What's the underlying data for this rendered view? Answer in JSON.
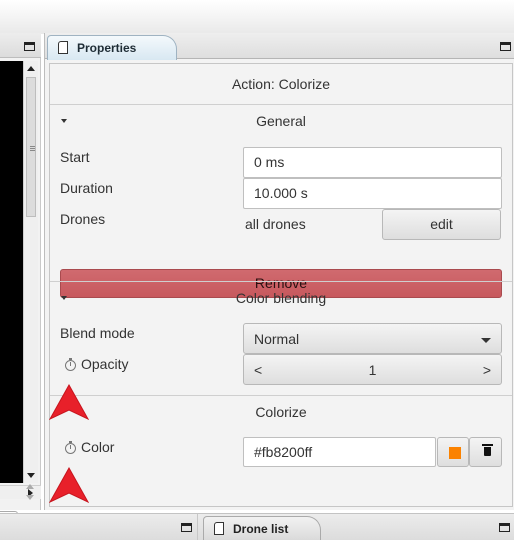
{
  "properties_tab": {
    "label": "Properties"
  },
  "action": {
    "title": "Action: Colorize"
  },
  "general": {
    "title": "General",
    "start_label": "Start",
    "start_value": "0 ms",
    "duration_label": "Duration",
    "duration_value": "10.000 s",
    "drones_label": "Drones",
    "drones_value": "all drones",
    "edit_label": "edit",
    "remove_label": "Remove"
  },
  "color_blending": {
    "title": "Color blending",
    "blend_mode_label": "Blend mode",
    "blend_mode_value": "Normal",
    "opacity_label": "Opacity",
    "opacity_value": "1",
    "decrement_glyph": "<",
    "increment_glyph": ">"
  },
  "colorize": {
    "title": "Colorize",
    "color_label": "Color",
    "color_value": "#fb8200ff",
    "swatch_color": "#fb8200"
  },
  "bottom": {
    "drone_list_tab": "Drone list"
  },
  "icons": {
    "tab_icon": "document-icon",
    "maximize": "maximize-icon",
    "collapse": "caret-down-icon",
    "animated_property": "stopwatch-icon",
    "delete": "trash-icon",
    "pointer": "red-arrow-pointer-icon"
  },
  "colors": {
    "remove_button": "#c7585d",
    "tab_active": "#d8e8f2",
    "cursor_red": "#e8202a"
  }
}
